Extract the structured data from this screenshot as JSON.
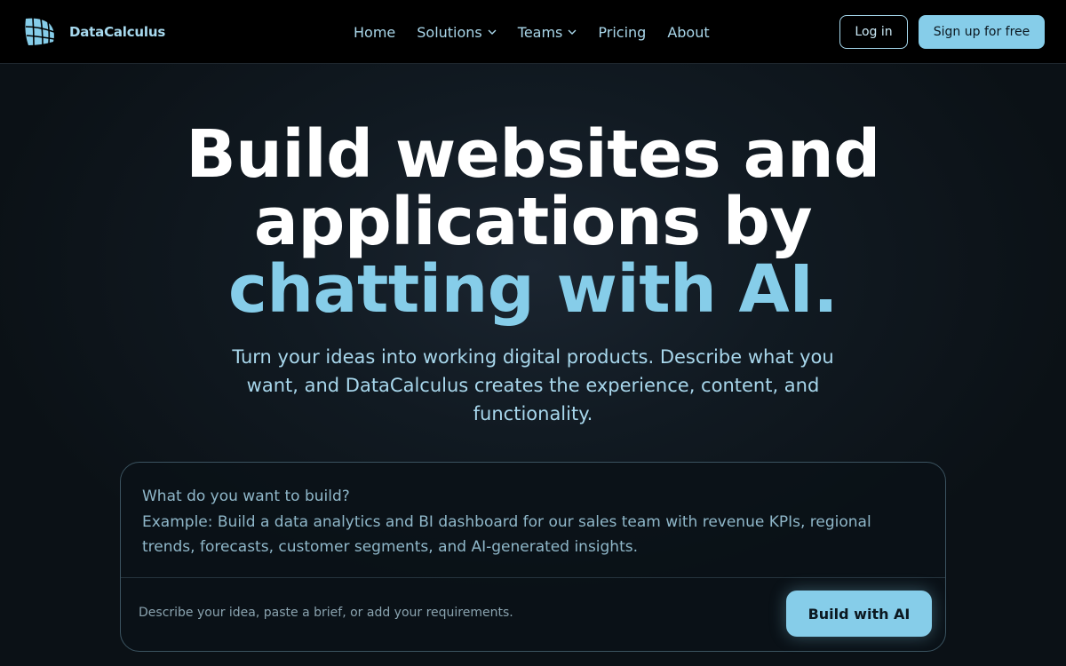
{
  "brand": {
    "name": "DataCalculus",
    "logo_icon": "globe-grid-logo",
    "color": "#a7d9ee"
  },
  "nav": {
    "links": [
      {
        "label": "Home",
        "has_dropdown": false
      },
      {
        "label": "Solutions",
        "has_dropdown": true
      },
      {
        "label": "Teams",
        "has_dropdown": true
      },
      {
        "label": "Pricing",
        "has_dropdown": false
      },
      {
        "label": "About",
        "has_dropdown": false
      }
    ],
    "login_label": "Log in",
    "signup_label": "Sign up for free"
  },
  "hero": {
    "title_line1": "Build websites and",
    "title_line2": "applications by",
    "title_accent": "chatting with AI.",
    "subtitle": "Turn your ideas into working digital products. Describe what you want, and DataCalculus creates the experience, content, and functionality."
  },
  "prompt": {
    "placeholder": "What do you want to build?\nExample: Build a data analytics and BI dashboard for our sales team with revenue KPIs, regional trends, forecasts, customer segments, and AI-generated insights.",
    "question": "What do you want to build?",
    "example": "Example: Build a data analytics and BI dashboard for our sales team with revenue KPIs, regional trends, forecasts, customer segments, and AI-generated insights.",
    "hint": "Describe your idea, paste a brief, or add your requirements.",
    "submit_label": "Build with AI"
  },
  "colors": {
    "accent": "#86cde9",
    "background": "#0b1116",
    "nav_background": "#000000"
  }
}
